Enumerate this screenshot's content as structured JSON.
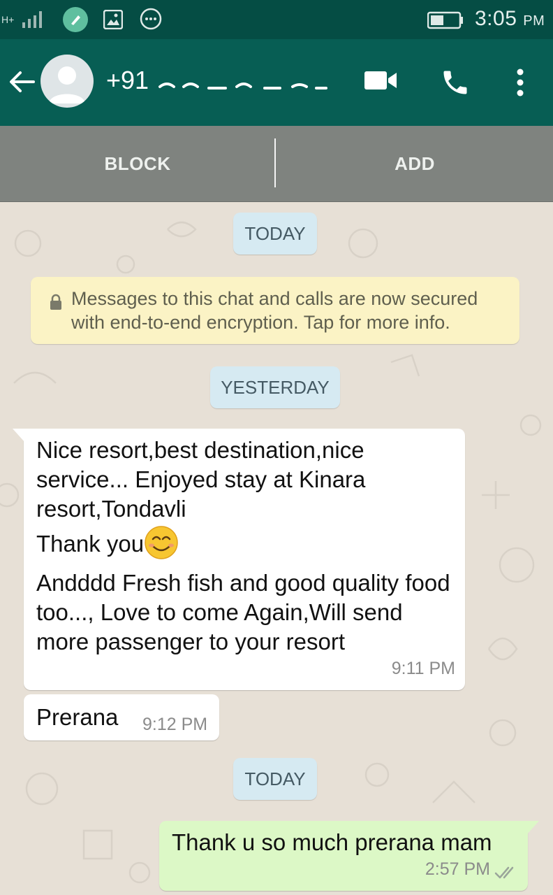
{
  "status_bar": {
    "network": "H+",
    "time": "3:05",
    "time_suffix": "PM"
  },
  "toolbar": {
    "contact": "+91"
  },
  "actions": {
    "block": "BLOCK",
    "add": "ADD"
  },
  "chat": {
    "date_today_1": "TODAY",
    "encryption_notice": "Messages to this chat and calls are now secured with end-to-end encryption. Tap for more info.",
    "date_yesterday": "YESTERDAY",
    "messages": [
      {
        "direction": "incoming",
        "paragraphs": [
          "Nice resort,best destination,nice service... Enjoyed stay at Kinara resort,Tondavli",
          "Thank you",
          "Andddd Fresh fish and good quality food too..., Love to come Again,Will send more passenger to your resort"
        ],
        "emoji": "smiling-face-emoji",
        "time": "9:11 PM"
      },
      {
        "direction": "incoming",
        "text": "Prerana",
        "time": "9:12 PM"
      },
      {
        "direction": "outgoing",
        "text": "Thank u so much prerana mam",
        "time": "2:57 PM",
        "status": "read-ticks-icon"
      }
    ],
    "date_today_2": "TODAY"
  },
  "colors": {
    "status_bar": "#054d44",
    "toolbar": "#075e54",
    "action_bar": "#7f837f",
    "outgoing_bubble": "#dcf8c6",
    "date_chip": "#d6eaf2",
    "encryption_notice": "#fbf3c5",
    "chat_background": "#e7e0d6"
  }
}
